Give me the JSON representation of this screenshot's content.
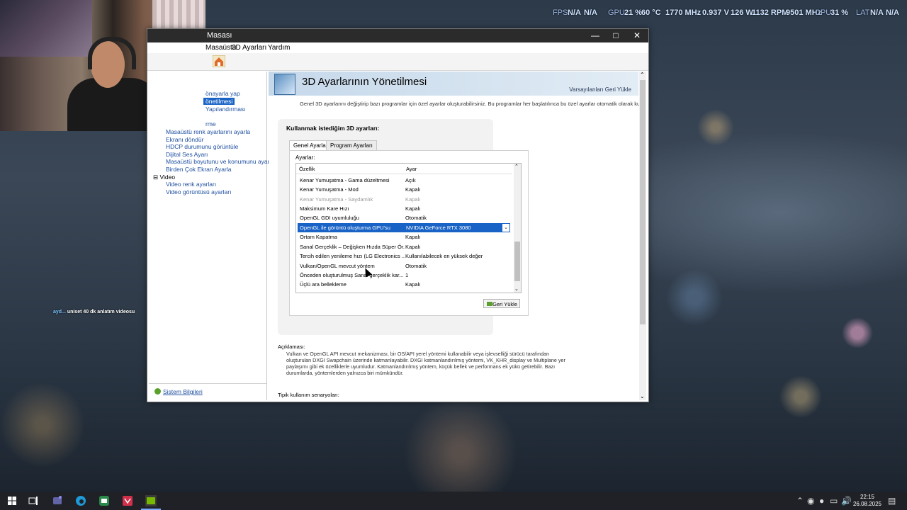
{
  "overlay": {
    "fps_label": "FPS",
    "fps_value": "N/A",
    "fps_value2": "N/A",
    "gpu_label": "GPU",
    "gpu_usage": "21 %",
    "gpu_temp": "60 °C",
    "gpu_clock": "1770 MHz",
    "gpu_volt": "0.937 V",
    "gpu_power": "126 W",
    "gpu_fan": "1132 RPM",
    "gpu_mem": "9501 MHz",
    "cpu_label": "CPU",
    "cpu_usage": "31 %",
    "lat_label": "LAT",
    "lat_value": "N/A",
    "lat_value2": "N/A"
  },
  "window": {
    "title": "Masası",
    "menu": [
      "Masaüstü",
      "3D Ayarları",
      "Yardım"
    ]
  },
  "sidebar": {
    "items": [
      {
        "label": "önayarla yap"
      },
      {
        "label": "önetilmesi"
      },
      {
        "label": "Yapılandırması"
      },
      {
        "label": "rme"
      },
      {
        "label": "Masaüstü renk ayarlarını ayarla"
      },
      {
        "label": "Ekranı döndür"
      },
      {
        "label": "HDCP durumunu görüntüle"
      },
      {
        "label": "Dijital Ses Ayarı"
      },
      {
        "label": "Masaüstü boyutunu ve konumunu ayarla"
      },
      {
        "label": "Birden Çok Ekran Ayarla"
      },
      {
        "label": "Video"
      },
      {
        "label": "Video renk ayarları"
      },
      {
        "label": "Video görüntüsü ayarları"
      }
    ],
    "system_info": "Sistem Bilgileri"
  },
  "main": {
    "title": "3D Ayarlarının Yönetilmesi",
    "restore_defaults": "Varsayılanları Geri Yükle",
    "intro": "Genel 3D ayarlarını değiştirip bazı programlar için özel ayarlar oluşturabilirsiniz. Bu programlar her başlatılınca bu özel ayarlar otomatik olarak kullanılacaktır.",
    "section_heading": "Kullanmak istediğim 3D ayarları:",
    "tabs": [
      "Genel Ayarlar",
      "Program Ayarları"
    ],
    "settings_label": "Ayarlar:",
    "col_feature": "Özellik",
    "col_setting": "Ayar",
    "rows": [
      {
        "feature": "Kenar Yumuşatma - Gama düzeltmesi",
        "value": "Açık"
      },
      {
        "feature": "Kenar Yumuşatma - Mod",
        "value": "Kapalı"
      },
      {
        "feature": "Kenar Yumuşatma - Saydamlık",
        "value": "Kapalı"
      },
      {
        "feature": "Maksimum Kare Hızı",
        "value": "Kapalı"
      },
      {
        "feature": "OpenGL GDI uyumluluğu",
        "value": "Otomatik"
      },
      {
        "feature": "OpenGL ile görüntü oluşturma GPU'su",
        "value": "NVIDIA GeForce RTX 3080"
      },
      {
        "feature": "Ortam Kapatma",
        "value": "Kapalı"
      },
      {
        "feature": "Sanal Gerçeklik – Değişken Hızda Süper Ör...",
        "value": "Kapalı"
      },
      {
        "feature": "Tercih edilen yenileme hızı (LG Electronics ...",
        "value": "Kullanılabilecek en yüksek değer"
      },
      {
        "feature": "Vulkan/OpenGL mevcut yöntem",
        "value": "Otomatik"
      },
      {
        "feature": "Önceden oluşturulmuş Sanal gerçeklik kar...",
        "value": "1"
      },
      {
        "feature": "Üçlü ara bellekleme",
        "value": "Kapalı"
      }
    ],
    "restore_button": "Geri Yükle",
    "desc_heading": "Açıklaması:",
    "desc_text": "Vulkan ve OpenGL API mevcut mekanizması, bir OS/API yerel yöntemi kullanabilir veya işlevselliği sürücü tarafından oluşturulan DXGI Swapchain üzerinde katmanlayabilir. DXGI katmanlandırılmış yöntemi, VK_KHR_display ve Multiplane yer paylaşımı gibi ek özelliklerle uyumludur. Katmanlandırılmış yöntem, küçük bellek ve performans ek yükü getirebilir. Bazı durumlarda, yöntemlerden yalnızca biri mümkündür.",
    "typical_heading": "Tipik kullanım senaryoları:"
  },
  "chat": {
    "user": "ayd...",
    "message": "uniset 40 dk anlatım videosu"
  },
  "taskbar": {
    "time": "22:15",
    "date": "26.08.2025"
  }
}
